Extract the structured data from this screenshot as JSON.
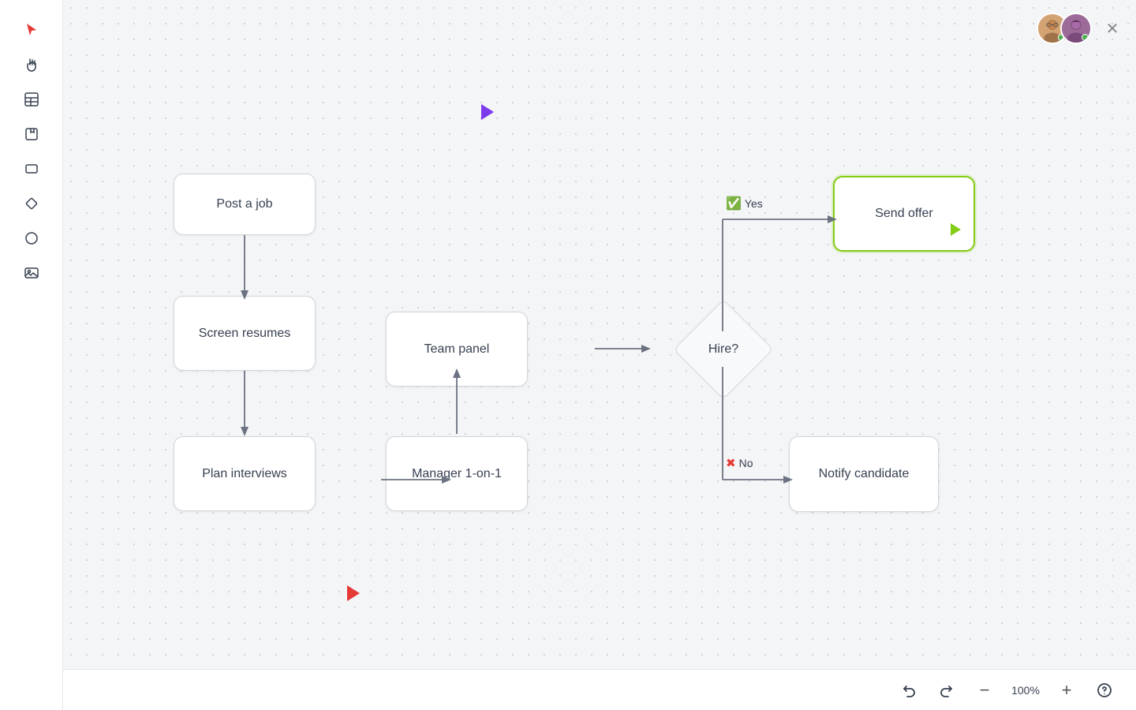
{
  "toolbar": {
    "tools": [
      {
        "name": "cursor",
        "icon": "▶",
        "active": true
      },
      {
        "name": "hand",
        "icon": "✋",
        "active": false
      },
      {
        "name": "table",
        "icon": "▤",
        "active": false
      },
      {
        "name": "sticky",
        "icon": "📝",
        "active": false
      },
      {
        "name": "rectangle",
        "icon": "▭",
        "active": false
      },
      {
        "name": "diamond",
        "icon": "◇",
        "active": false
      },
      {
        "name": "circle",
        "icon": "○",
        "active": false
      },
      {
        "name": "image",
        "icon": "🖼",
        "active": false
      }
    ]
  },
  "nodes": {
    "post_job": "Post a job",
    "screen_resumes": "Screen resumes",
    "plan_interviews": "Plan interviews",
    "team_panel": "Team panel",
    "manager_1on1": "Manager 1-on-1",
    "hire_question": "Hire?",
    "send_offer": "Send offer",
    "notify_candidate": "Notify candidate"
  },
  "branch_labels": {
    "yes": "Yes",
    "no": "No"
  },
  "bottom": {
    "zoom": "100%"
  },
  "cursors": {
    "purple_top": "▶",
    "red_bottom": "▶"
  }
}
